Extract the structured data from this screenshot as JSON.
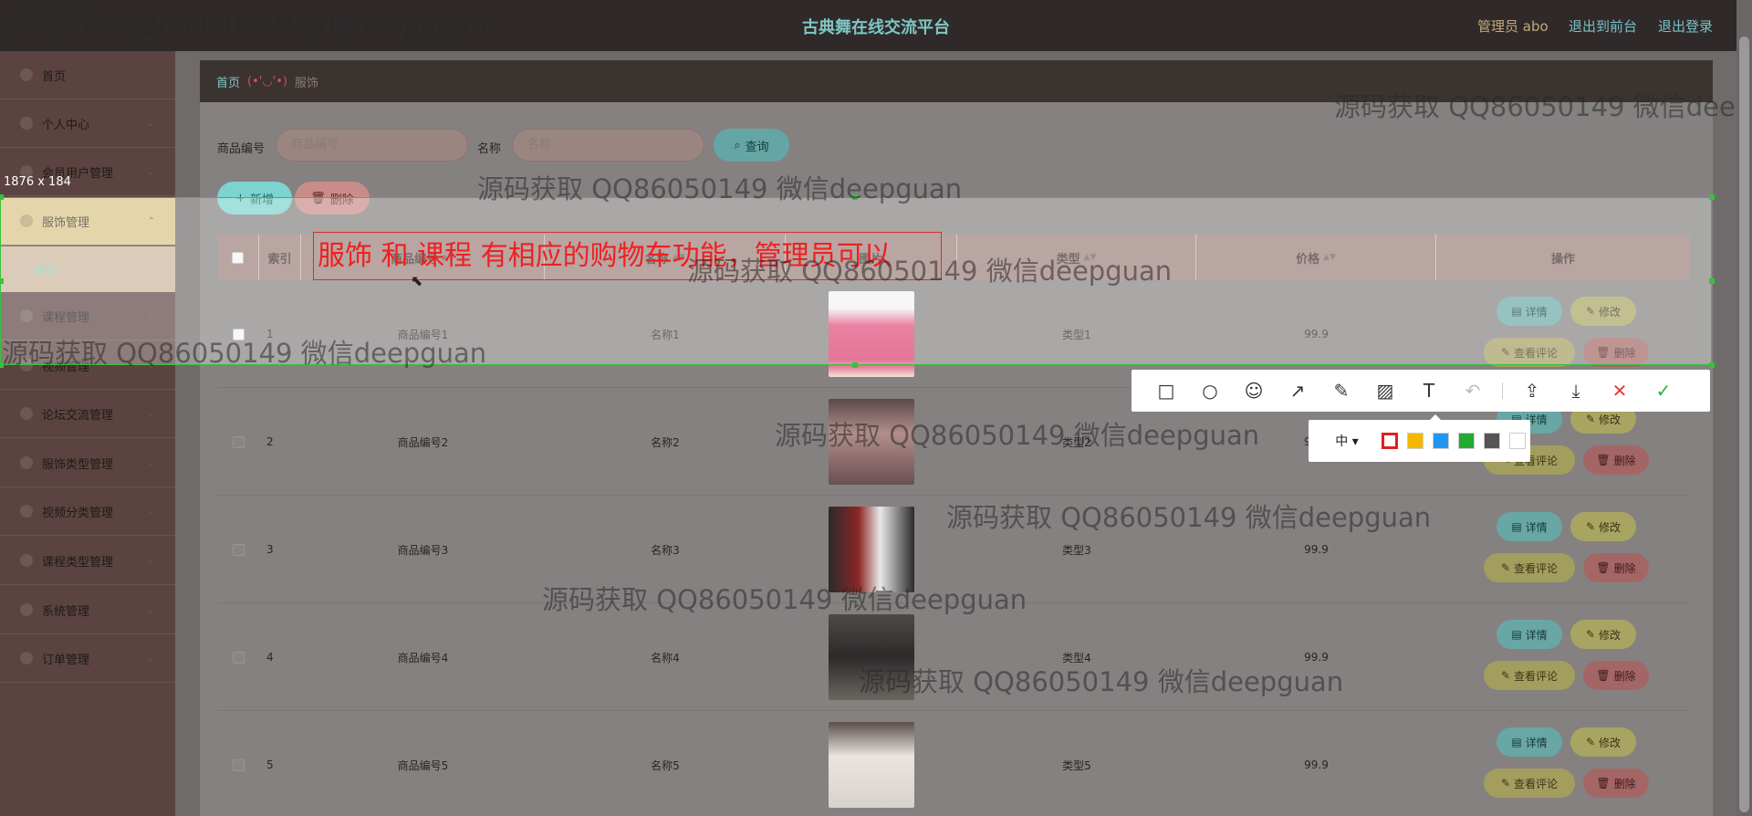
{
  "header": {
    "title": "古典舞在线交流平台",
    "user_label": "管理员 abo",
    "front_link": "退出到前台",
    "logout_link": "退出登录"
  },
  "sidebar": {
    "items": [
      {
        "label": "首页"
      },
      {
        "label": "个人中心"
      },
      {
        "label": "会员用户管理"
      },
      {
        "label": "服饰管理"
      },
      {
        "label": "课程管理"
      },
      {
        "label": "视频管理"
      },
      {
        "label": "论坛交流管理"
      },
      {
        "label": "服饰类型管理"
      },
      {
        "label": "视频分类管理"
      },
      {
        "label": "课程类型管理"
      },
      {
        "label": "系统管理"
      },
      {
        "label": "订单管理"
      }
    ],
    "sub_item": "服饰"
  },
  "breadcrumb": {
    "home": "首页",
    "face": "(•'◡'•)",
    "current": "服饰"
  },
  "search": {
    "code_label": "商品编号",
    "code_placeholder": "商品编号",
    "name_label": "名称",
    "name_placeholder": "名称",
    "query_button": "查询"
  },
  "actions": {
    "add": "新增",
    "delete": "删除"
  },
  "table": {
    "headers": [
      "索引",
      "商品编号",
      "名称",
      "图片",
      "类型",
      "价格",
      "操作"
    ],
    "rows": [
      {
        "index": "1",
        "code": "商品编号1",
        "name": "名称1",
        "type": "类型1",
        "price": "99.9"
      },
      {
        "index": "2",
        "code": "商品编号2",
        "name": "名称2",
        "type": "类型2",
        "price": "99.9"
      },
      {
        "index": "3",
        "code": "商品编号3",
        "name": "名称3",
        "type": "类型3",
        "price": "99.9"
      },
      {
        "index": "4",
        "code": "商品编号4",
        "name": "名称4",
        "type": "类型4",
        "price": "99.9"
      },
      {
        "index": "5",
        "code": "商品编号5",
        "name": "名称5",
        "type": "类型5",
        "price": "99.9"
      }
    ],
    "op_labels": {
      "detail": "详情",
      "edit": "修改",
      "comment": "查看评论",
      "delete": "删除"
    }
  },
  "capture": {
    "size_label": "1876 x 184",
    "note_text": "服饰 和 课程 有相应的购物车功能，管理员可以",
    "size_option": "中",
    "colors": [
      "#e02020",
      "#f5b800",
      "#2196f3",
      "#22aa33",
      "#555555",
      "#ffffff"
    ]
  },
  "watermark": "源码获取 QQ86050149 微信deepguan"
}
